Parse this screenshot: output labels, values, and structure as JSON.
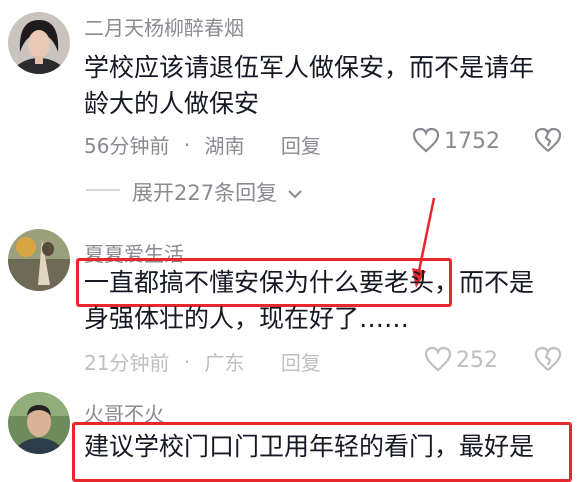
{
  "comments": [
    {
      "username": "二月天杨柳醉春烟",
      "text_line1": "学校应该请退伍军人做保安，而不是请年",
      "text_line2": "龄大的人做保安",
      "time": "56分钟前",
      "dot": "·",
      "location": "湖南",
      "reply": "回复",
      "likes": "1752"
    },
    {
      "username": "夏夏爱生活",
      "highlight": "一直都搞不懂安保为什么要老头",
      "text_line1_rest": "，而不是",
      "text_line2": "身强体壮的人，现在好了……",
      "time": "21分钟前",
      "dot": "·",
      "location": "广东",
      "reply": "回复",
      "likes": "252"
    },
    {
      "username": "火哥不火",
      "text_line1": "建议学校门口门卫用年轻的看门，最好是"
    }
  ],
  "expand_replies": "展开227条回复",
  "colors": {
    "highlight_border": "#e8262d",
    "meta_text": "#8a8b91",
    "body_text": "#161823"
  }
}
